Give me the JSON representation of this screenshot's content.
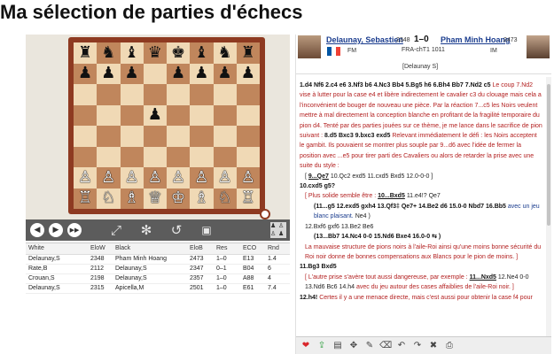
{
  "page": {
    "title": "Ma sélection de parties d'échecs"
  },
  "board": {
    "ranks": [
      [
        "♜",
        "♞",
        "♝",
        "♛",
        "♚",
        "♝",
        "♞",
        "♜"
      ],
      [
        "♟",
        "♟",
        "♟",
        "",
        "♟",
        "♟",
        "♟",
        "♟"
      ],
      [
        "",
        "",
        "",
        "",
        "",
        "",
        "",
        ""
      ],
      [
        "",
        "",
        "",
        "♟",
        "",
        "",
        "",
        ""
      ],
      [
        "",
        "",
        "",
        "",
        "",
        "",
        "",
        ""
      ],
      [
        "",
        "",
        "",
        "",
        "",
        "",
        "",
        ""
      ],
      [
        "♙",
        "♙",
        "♙",
        "♙",
        "♙",
        "♙",
        "♙",
        "♙"
      ],
      [
        "♖",
        "♘",
        "♗",
        "♕",
        "♔",
        "♗",
        "♘",
        "♖"
      ]
    ],
    "black_rows": [
      0,
      1,
      3
    ],
    "colors": {
      "light": "#f0d9b5",
      "dark": "#c0865c",
      "frame": "#8e3a21"
    }
  },
  "controls": {
    "icons": [
      "prev-icon",
      "next-icon",
      "last-icon",
      "fullscreen-icon",
      "settings-wheel-icon",
      "undo-icon",
      "save-icon",
      "flip-board-icon"
    ],
    "glyphs": [
      "◀",
      "▶",
      "▶▶",
      "⤢",
      "✻",
      "↺",
      "💾",
      "♟"
    ]
  },
  "games": {
    "columns": [
      "White",
      "EloW",
      "Black",
      "EloB",
      "Res",
      "ECO",
      "Rnd"
    ],
    "rows": [
      [
        "Delaunay,S",
        "2348",
        "Pham Minh Hoang",
        "2473",
        "1–0",
        "E13",
        "1.4"
      ],
      [
        "Rate,B",
        "2112",
        "Delaunay,S",
        "2347",
        "0–1",
        "B04",
        "6"
      ],
      [
        "Crouan,S",
        "2198",
        "Delaunay,S",
        "2357",
        "1–0",
        "A88",
        "4"
      ],
      [
        "Delaunay,S",
        "2315",
        "Apicella,M",
        "2501",
        "1–0",
        "E61",
        "7.4"
      ]
    ]
  },
  "header": {
    "white_name": "Delaunay, Sebastien",
    "white_elo": "2348",
    "white_title": "FM",
    "result": "1–0",
    "black_name": "Pham Minh Hoang",
    "black_elo": "2473",
    "black_title": "IM",
    "event": "FRA-chT1 1011",
    "annotator": "[Delaunay S]",
    "flag_colors": [
      "#0055a4",
      "#ffffff",
      "#ef4135"
    ]
  },
  "notation": {
    "opening": "1.d4 Nf6 2.c4 e6 3.Nf3 b6 4.Nc3 Bb4 5.Bg5 h6 6.Bh4 Bb7 7.Nd2 c5",
    "p1_comment": "Le coup 7.Nd2 vise à lutter pour la case e4 et libère indirectement le cavalier c3 du clouage mais cela a l'inconvénient de bouger de nouveau une pièce. Par la réaction 7...c5 les Noirs veulent mettre à mal directement la conception blanche en profitant de la fragilité temporaire du pion d4. Tenté par des parties jouées sur ce thème, je me lance dans le sacrifice de pion suivant :",
    "p1_moves": "8.d5 Bxc3 9.bxc3 exd5",
    "p1_comment2": "Relevant immédiatement le défi : les Noirs acceptent le gambit. Ils pouvaient se montrer plus souple par 9...d6 avec l'idée de fermer la position avec ...e5 pour tirer parti des Cavaliers ou alors de retarder la prise avec une suite du style :",
    "var1_a": "9...Qe7",
    "var1_b": "10.Qc2 exd5 11.cxd5 Bxd5 12.0-0-0 ]",
    "move10": "10.cxd5 g5?",
    "var2_intro": "Plus solide semble être :",
    "var2_a": "10...Bxd5",
    "var2_b": "11.e4!? Qe7",
    "var3": "(11...g5 12.exd5 gxh4 13.Qf3‡ Qe7+ 14.Be2 d6 15.0-0 Nbd7 16.Bb5",
    "var3_tail": "avec un jeu blanc plaisant.",
    "var3_end": "Ne4 )",
    "line12": "12.Bxf6 gxf6 13.Be2 Be6",
    "var4": "(13...Bb7 14.Nc4 0-0 15.Nd6 Bxe4 16.0-0 ⇆ )",
    "line13": "La mauvaise structure de pions noirs à l'aile-Roi ainsi qu'une moins bonne sécurité du Roi noir donne de bonnes compensations aux Blancs pour le pion de moins. ]",
    "move11": "11.Bg3 Bxd5",
    "var5_intro": "L'autre prise s'avère tout aussi dangereuse, par exemple :",
    "var5_a": "11...Nxd5",
    "var5_b": "12.Ne4 0-0",
    "var5_c": "13.Nd6 Bc6 14.h4",
    "var5_d": "avec du jeu autour des cases affaiblies de l'aile-Roi noir. ]",
    "move12": "12.h4!",
    "move12_comment": "Certes il y a une menace directe, mais c'est aussi pour obtenir la case f4 pour"
  },
  "toolbar": {
    "icons": [
      "heart-icon",
      "share-icon",
      "save-icon",
      "move-icon",
      "pin-icon",
      "eraser-icon",
      "undo-icon",
      "redo-icon",
      "trash-icon",
      "print-icon"
    ],
    "glyphs": [
      "❤",
      "⇪",
      "▤",
      "✥",
      "✎",
      "⌫",
      "↶",
      "↷",
      "🗑",
      "⎙"
    ]
  }
}
